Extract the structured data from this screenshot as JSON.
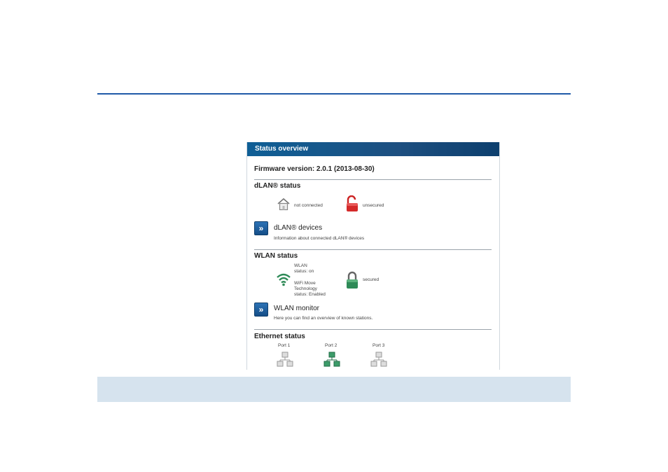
{
  "header": {
    "title": "Status overview"
  },
  "firmware": {
    "label": "Firmware version: 2.0.1 (2013-08-30)"
  },
  "dlan_status": {
    "title": "dLAN® status",
    "connection": "not connected",
    "security": "unsecured"
  },
  "dlan_devices": {
    "title": "dLAN® devices",
    "description": "Information about connected dLAN® devices",
    "button_glyph": "»"
  },
  "wlan_status": {
    "title": "WLAN status",
    "wlan_line1": "WLAN",
    "wlan_line2": "status: on",
    "wifi_line1": "WiFi Move",
    "wifi_line2": "Technology",
    "wifi_line3": "status: Enabled",
    "security": "secured"
  },
  "wlan_monitor": {
    "title": "WLAN monitor",
    "description": "Here you can find an overview of known stations.",
    "button_glyph": "»"
  },
  "ethernet_status": {
    "title": "Ethernet status",
    "ports": [
      {
        "label": "Port 1",
        "state": "inactive"
      },
      {
        "label": "Port 2",
        "state": "active"
      },
      {
        "label": "Port 3",
        "state": "inactive"
      }
    ]
  },
  "colors": {
    "header_blue": "#1d4f80",
    "rule_blue": "#1f5aa8",
    "band": "#d6e3ee",
    "unsecured_red": "#d42a2a",
    "secured_green": "#2e8a57"
  }
}
